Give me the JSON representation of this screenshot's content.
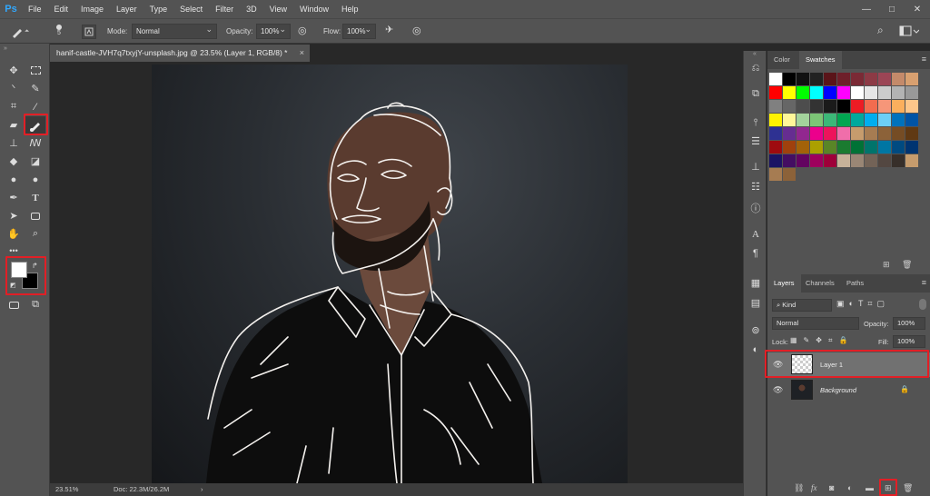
{
  "menubar": {
    "logo": "Ps",
    "items": [
      "File",
      "Edit",
      "Image",
      "Layer",
      "Type",
      "Select",
      "Filter",
      "3D",
      "View",
      "Window",
      "Help"
    ],
    "minimize": "—",
    "maximize": "□",
    "close": "✕"
  },
  "options": {
    "brush_size": "5",
    "mode_label": "Mode:",
    "mode_value": "Normal",
    "opacity_label": "Opacity:",
    "opacity_value": "100%",
    "flow_label": "Flow:",
    "flow_value": "100%"
  },
  "document": {
    "tab_title": "hanif-castle-JVH7q7txyjY-unsplash.jpg @ 23.5% (Layer 1, RGB/8) *",
    "close": "×"
  },
  "status": {
    "zoom": "23.51%",
    "doc_size": "Doc: 22.3M/26.2M",
    "arrow": "›"
  },
  "swatches_panel": {
    "tabs": [
      "Color",
      "Swatches"
    ],
    "active_tab": "Swatches",
    "colors": [
      "#ffffff",
      "#000000",
      "#111111",
      "#222222",
      "#5a1419",
      "#6e1f2a",
      "#7a2a35",
      "#8c3a45",
      "#9b4555",
      "#c48a6a",
      "#d8a070",
      "#ff0000",
      "#ffff00",
      "#00ff00",
      "#00ffff",
      "#0000ff",
      "#ff00ff",
      "#ffffff",
      "#e6e6e6",
      "#cccccc",
      "#b3b3b3",
      "#999999",
      "#808080",
      "#666666",
      "#4d4d4d",
      "#333333",
      "#1a1a1a",
      "#000000",
      "#ed1c24",
      "#f26c4f",
      "#f69679",
      "#fbaf5d",
      "#fdc68a",
      "#fff200",
      "#fff799",
      "#a3d39c",
      "#7cc576",
      "#3cb878",
      "#00a651",
      "#00a99d",
      "#00aeef",
      "#6dcff6",
      "#0072bc",
      "#0054a6",
      "#2e3192",
      "#662d91",
      "#92278f",
      "#ec008c",
      "#ed145b",
      "#f06eaa",
      "#c69c6d",
      "#a67c52",
      "#8c6239",
      "#754c24",
      "#603913",
      "#9e0b0f",
      "#a0410d",
      "#a36209",
      "#aba000",
      "#598527",
      "#1a7b30",
      "#007236",
      "#00746b",
      "#0076a3",
      "#004a80",
      "#003471",
      "#1b1464",
      "#440e62",
      "#630460",
      "#9e005d",
      "#9e0039",
      "#c7b299",
      "#998675",
      "#736357",
      "#534741",
      "#372f2a",
      "#c69c6d",
      "#a67c52",
      "#8c6239"
    ]
  },
  "layers_panel": {
    "tabs": [
      "Layers",
      "Channels",
      "Paths"
    ],
    "active_tab": "Layers",
    "kind_label": "Kind",
    "blend_mode": "Normal",
    "opacity_label": "Opacity:",
    "opacity_value": "100%",
    "lock_label": "Lock:",
    "fill_label": "Fill:",
    "fill_value": "100%",
    "layers": [
      {
        "name": "Layer 1",
        "selected": true
      },
      {
        "name": "Background",
        "selected": false
      }
    ]
  }
}
